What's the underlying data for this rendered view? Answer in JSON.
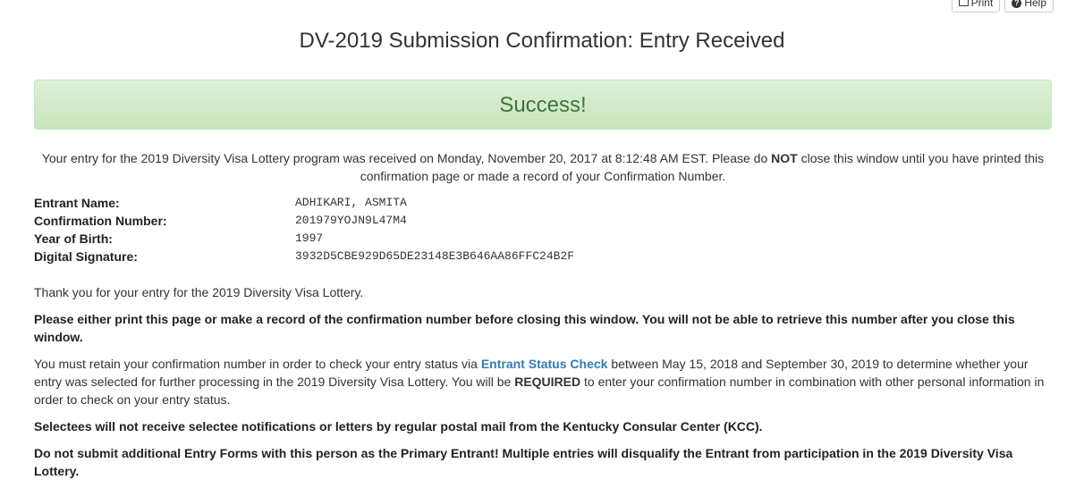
{
  "toolbar": {
    "print_label": "Print",
    "help_label": "Help"
  },
  "page": {
    "title": "DV-2019 Submission Confirmation: Entry Received"
  },
  "alert": {
    "text": "Success!"
  },
  "intro": {
    "part1": "Your entry for the 2019 Diversity Visa Lottery program was received on Monday, November 20, 2017 at 8:12:48 AM EST. Please do ",
    "emphasis": "NOT",
    "part2": " close this window until you have printed this confirmation page or made a record of your Confirmation Number."
  },
  "details": {
    "entrant_name_label": "Entrant Name:",
    "entrant_name_value": "ADHIKARI, ASMITA",
    "confirmation_label": "Confirmation Number:",
    "confirmation_value": "201979YOJN9L47M4",
    "yob_label": "Year of Birth:",
    "yob_value": "1997",
    "signature_label": "Digital Signature:",
    "signature_value": "3932D5CBE929D65DE23148E3B646AA86FFC24B2F"
  },
  "body": {
    "thanks": "Thank you for your entry for the 2019 Diversity Visa Lottery.",
    "print_warning": "Please either print this page or make a record of the confirmation number before closing this window. You will not be able to retrieve this number after you close this window.",
    "retain_part1": "You must retain your confirmation number in order to check your entry status via ",
    "retain_link": "Entrant Status Check",
    "retain_part2": " between May 15, 2018 and September 30, 2019 to determine whether your entry was selected for further processing in the 2019 Diversity Visa Lottery. You will be ",
    "retain_required": "REQUIRED",
    "retain_part3": " to enter your confirmation number in combination with other personal information in order to check on your entry status.",
    "selectees_notice": "Selectees will not receive selectee notifications or letters by regular postal mail from the Kentucky Consular Center (KCC).",
    "no_additional": "Do not submit additional Entry Forms with this person as the Primary Entrant! Multiple entries will disqualify the Entrant from participation in the 2019 Diversity Visa Lottery."
  }
}
